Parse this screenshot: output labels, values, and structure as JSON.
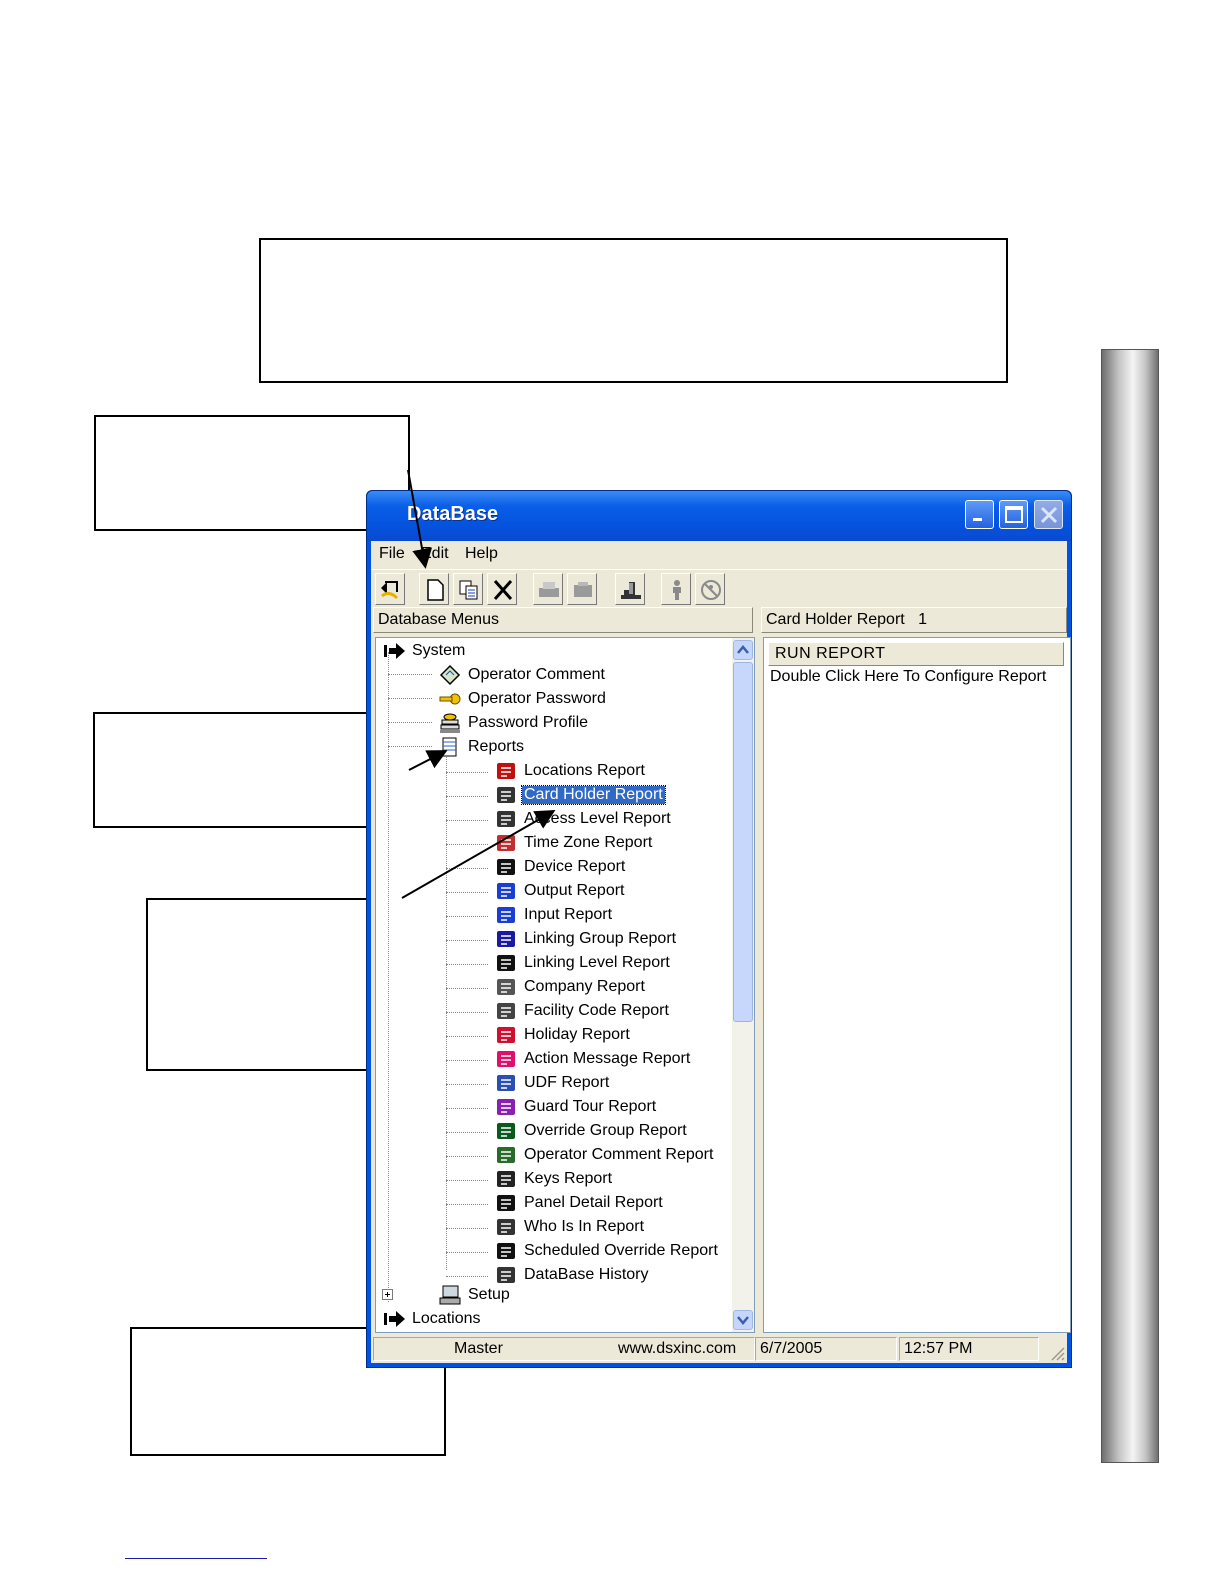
{
  "window": {
    "title": "DataBase",
    "min_icon": "minimize-icon",
    "max_icon": "maximize-icon",
    "close_icon": "close-icon"
  },
  "menu": {
    "file": "File",
    "edit": "Edit",
    "help": "Help"
  },
  "toolbar": [
    "return-icon",
    "new-icon",
    "copy-icon",
    "delete-icon",
    "print-icon",
    "preview-icon",
    "who-is-in-icon",
    "person-icon",
    "people-icon"
  ],
  "panels": {
    "left_title": "Database Menus",
    "right_title": "Card Holder Report   1"
  },
  "tree": {
    "system": "System",
    "operator_comment": "Operator Comment",
    "operator_password": "Operator Password",
    "password_profile": "Password Profile",
    "reports": "Reports",
    "report_items": [
      "Locations Report",
      "Card Holder Report",
      "Access Level Report",
      "Time Zone Report",
      "Device Report",
      "Output Report",
      "Input Report",
      "Linking Group Report",
      "Linking Level Report",
      "Company Report",
      "Facility Code Report",
      "Holiday Report",
      "Action Message Report",
      "UDF Report",
      "Guard Tour Report",
      "Override Group Report",
      "Operator Comment Report",
      "Keys Report",
      "Panel Detail Report",
      "Who Is In Report",
      "Scheduled Override Report",
      "DataBase History"
    ],
    "selected": "Card Holder Report",
    "setup": "Setup",
    "setup_expander": "+",
    "locations": "Locations"
  },
  "report_list": {
    "header": "RUN REPORT",
    "row": "Double Click Here To Configure Report"
  },
  "status": {
    "operator": "Master",
    "website": "www.dsxinc.com",
    "date": "6/7/2005",
    "time": "12:57 PM"
  },
  "colors": {
    "title_bar": "#0a5ee8",
    "selection": "#316ac5",
    "window_bg": "#ece9d8"
  }
}
